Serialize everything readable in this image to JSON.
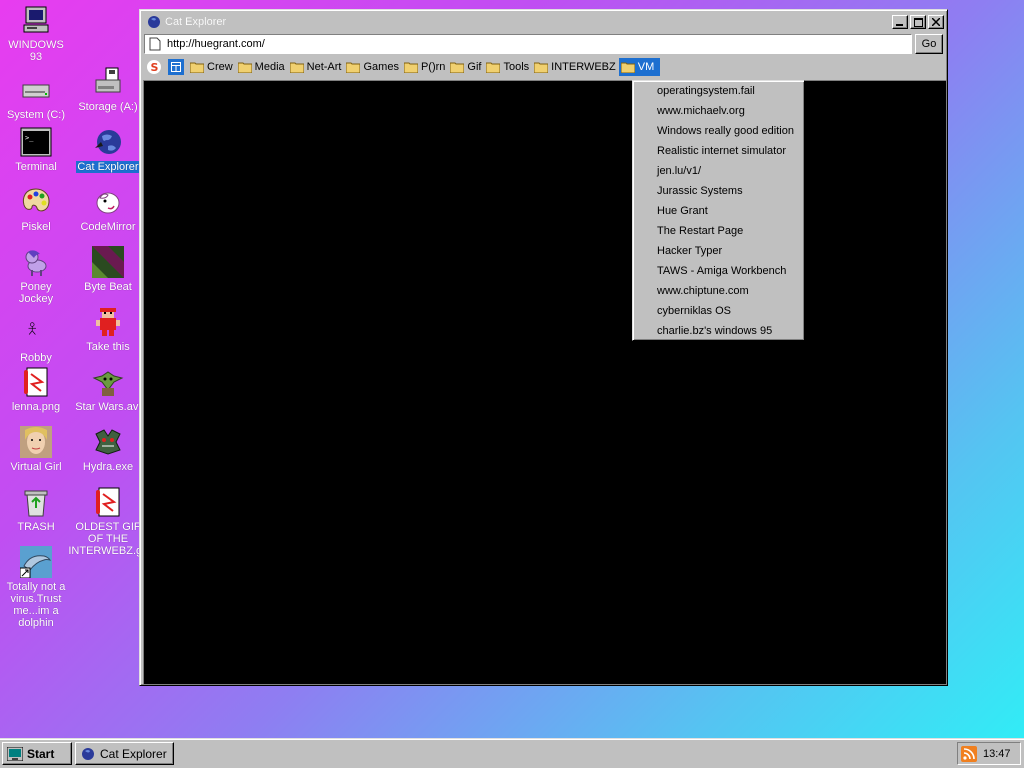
{
  "desktop": {
    "icons": [
      {
        "label": "WINDOWS 93",
        "icon": "computer-icon"
      },
      {
        "label": "System (C:)",
        "icon": "hard-drive-icon"
      },
      {
        "label": "Storage (A:)",
        "icon": "floppy-icon"
      },
      {
        "label": "Terminal",
        "icon": "terminal-icon"
      },
      {
        "label": "Cat Explorer",
        "icon": "globe-icon"
      },
      {
        "label": "Piskel",
        "icon": "palette-icon"
      },
      {
        "label": "CodeMirror",
        "icon": "codemirror-icon"
      },
      {
        "label": "Poney Jockey",
        "icon": "pony-icon"
      },
      {
        "label": "Byte Beat",
        "icon": "bytebeat-icon"
      },
      {
        "label": "Robby",
        "icon": "robby-icon"
      },
      {
        "label": "Take this",
        "icon": "take-this-icon"
      },
      {
        "label": "lenna.png",
        "icon": "image-file-icon"
      },
      {
        "label": "Star Wars.avi",
        "icon": "yoda-icon"
      },
      {
        "label": "Virtual Girl",
        "icon": "virtual-girl-icon"
      },
      {
        "label": "Hydra.exe",
        "icon": "hydra-icon"
      },
      {
        "label": "TRASH",
        "icon": "trash-icon"
      },
      {
        "label": "OLDEST GIF OF THE INTERWEBZ.gif",
        "icon": "gif-file-icon"
      },
      {
        "label": "Totally not a virus.Trust me...im a dolphin",
        "icon": "dolphin-icon"
      }
    ]
  },
  "window": {
    "title": "Cat Explorer",
    "address": "http://huegrant.com/",
    "go_label": "Go",
    "bookmarks": [
      "Crew",
      "Media",
      "Net-Art",
      "Games",
      "P()rn",
      "Gif",
      "Tools",
      "INTERWEBZ",
      "VM"
    ],
    "active_bookmark": "VM"
  },
  "dropdown": {
    "items": [
      "operatingsystem.fail",
      "www.michaelv.org",
      "Windows really good edition",
      "Realistic internet simulator",
      "jen.lu/v1/",
      "Jurassic Systems",
      "Hue Grant",
      "The Restart Page",
      "Hacker Typer",
      "TAWS - Amiga Workbench",
      "www.chiptune.com",
      "cyberniklas OS",
      "charlie.bz's windows 95"
    ]
  },
  "taskbar": {
    "start_label": "Start",
    "task_label": "Cat Explorer",
    "clock": "13:47"
  },
  "colors": {
    "selection": "#1d6fd0",
    "chrome": "#c0c0c0"
  }
}
